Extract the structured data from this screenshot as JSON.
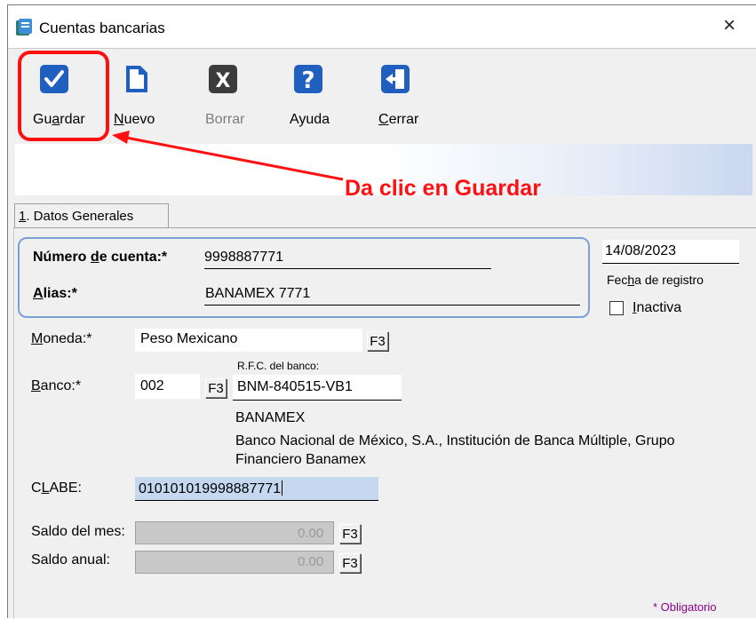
{
  "window": {
    "title": "Cuentas bancarias",
    "close_symbol": "×"
  },
  "toolbar": {
    "guardar": {
      "pre": "Gu",
      "acc": "a",
      "post": "rdar"
    },
    "nuevo": {
      "acc": "N",
      "post": "uevo"
    },
    "borrar": {
      "label": "Borrar"
    },
    "ayuda": {
      "label": "Ayuda"
    },
    "cerrar": {
      "acc": "C",
      "post": "errar"
    }
  },
  "annotation": {
    "text": "Da clic en Guardar",
    "color": "#ff1010"
  },
  "tabs": [
    {
      "prefix": "1",
      "label": ". Datos Generales"
    }
  ],
  "form": {
    "numero_cuenta": {
      "label_pre": "Número ",
      "label_acc": "d",
      "label_post": "e cuenta:*",
      "value": "9998887771"
    },
    "alias": {
      "label_acc": "A",
      "label_post": "lias:*",
      "value": "BANAMEX 7771"
    },
    "fecha_registro": {
      "value": "14/08/2023",
      "label_pre": "Fec",
      "label_acc": "h",
      "label_post": "a de registro"
    },
    "inactiva": {
      "label_acc": "I",
      "label_post": "nactiva",
      "checked": false
    },
    "moneda": {
      "label_acc": "M",
      "label_post": "oneda:*",
      "value": "Peso Mexicano",
      "lookup": "F3"
    },
    "banco": {
      "label_acc": "B",
      "label_post": "anco:*",
      "value": "002",
      "lookup": "F3"
    },
    "rfc_banco": {
      "label": "R.F.C. del banco:",
      "value": "BNM-840515-VB1"
    },
    "banco_nombre_corto": "BANAMEX",
    "banco_nombre_largo_1": "Banco Nacional de México, S.A., Institución de Banca Múltiple, Grupo",
    "banco_nombre_largo_2": "Financiero Banamex",
    "clabe": {
      "label_pre": "C",
      "label_acc": "L",
      "label_post": "ABE:",
      "value": "010101019998887771"
    },
    "saldo_mes": {
      "label": "Saldo del mes:",
      "value": "0.00",
      "lookup": "F3"
    },
    "saldo_anual": {
      "label": "Saldo anual:",
      "value": "0.00",
      "lookup": "F3"
    },
    "required_note": "* Obligatorio"
  },
  "colors": {
    "accent_blue": "#1f5fbf",
    "highlight_red": "#ff1010",
    "clabe_bg": "#c5d8f0"
  }
}
